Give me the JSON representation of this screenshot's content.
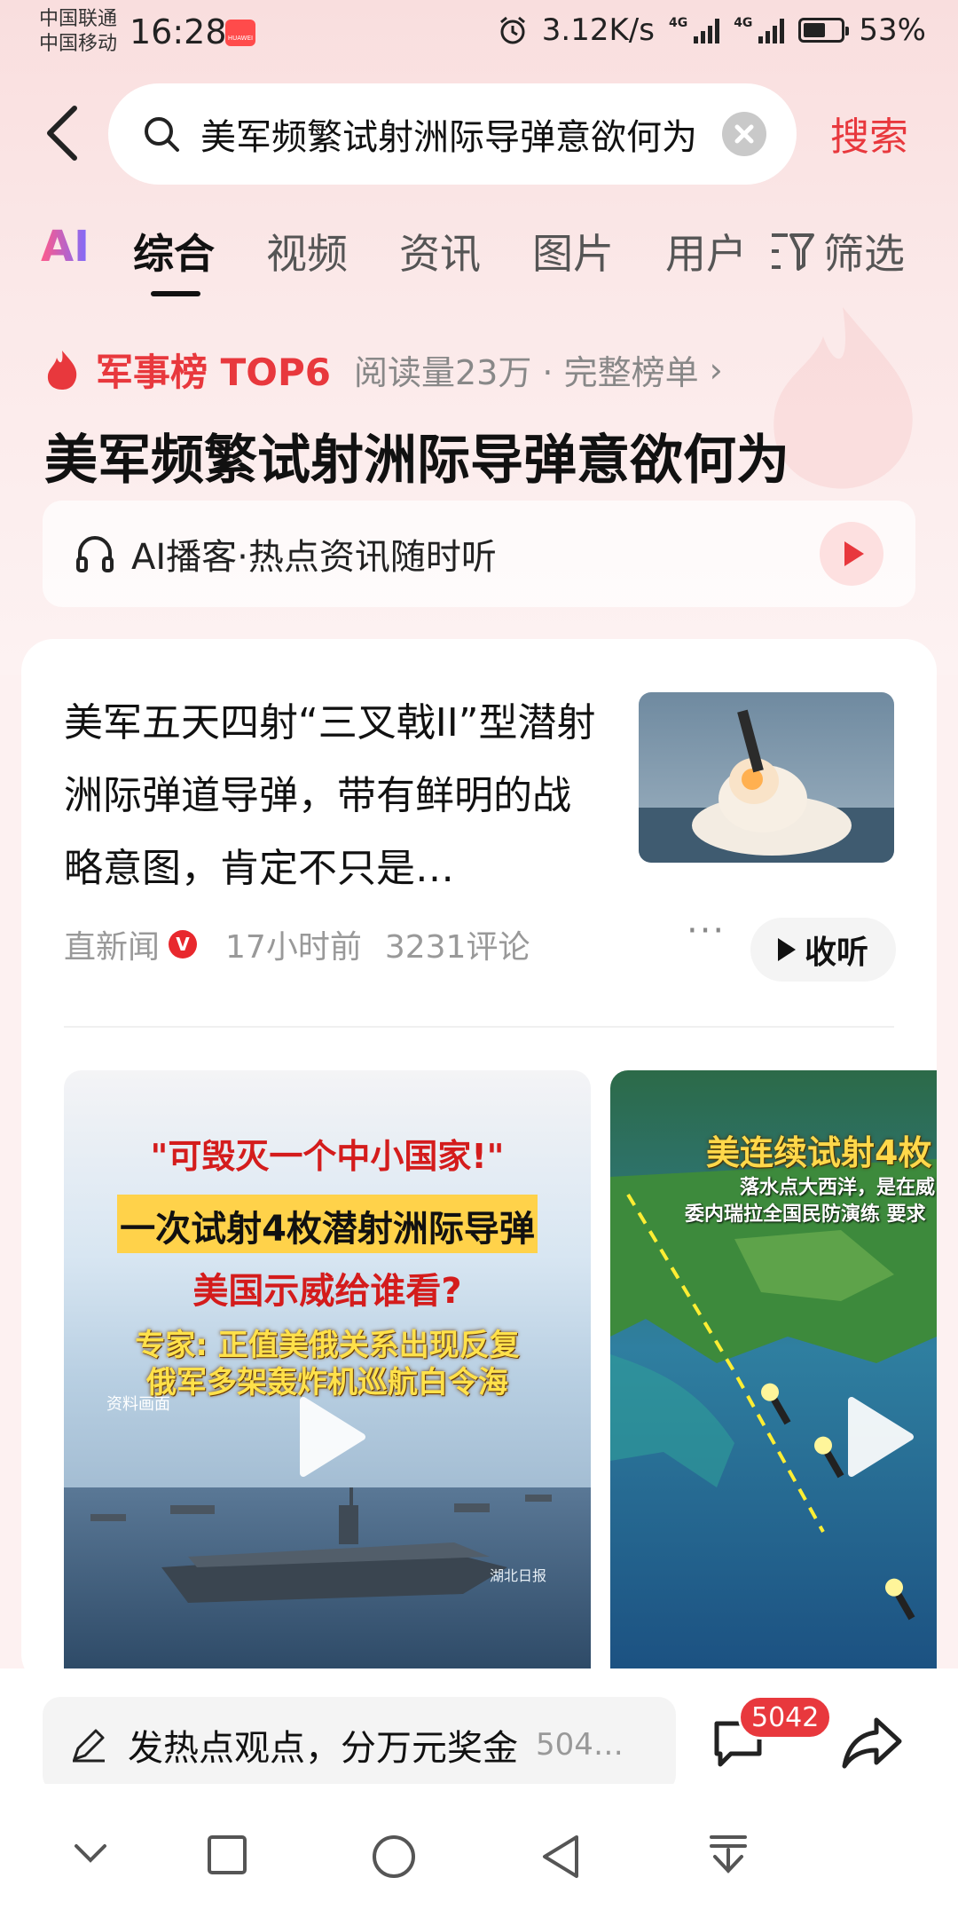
{
  "status_bar": {
    "carrier_1": "中国联通",
    "carrier_2": "中国移动",
    "time": "16:28",
    "network_speed": "3.12K/s",
    "signal_1": "4G",
    "signal_2": "4G",
    "battery": "53%"
  },
  "search": {
    "query": "美军频繁试射洲际导弹意欲何为",
    "submit_label": "搜索"
  },
  "tabs": {
    "ai": "AI",
    "items": [
      "综合",
      "视频",
      "资讯",
      "图片",
      "用户"
    ],
    "active": "综合",
    "filter_label": "筛选"
  },
  "hot_rank": {
    "rank_label": "军事榜 TOP6",
    "meta": "阅读量23万 · 完整榜单",
    "title": "美军频繁试射洲际导弹意欲何为"
  },
  "podcast": {
    "label": "AI播客·热点资讯随时听"
  },
  "article": {
    "title": "美军五天四射“三叉戟II”型潜射洲际弹道导弹，带有鲜明的战略意图，肯定不只是…",
    "source": "直新闻",
    "time": "17小时前",
    "comments": "3231评论",
    "more": "···",
    "listen_label": "收听"
  },
  "videos": [
    {
      "line1": "\"可毁灭一个中小国家!\"",
      "line2": "一次试射4枚潜射洲际导弹",
      "line3": "美国示威给谁看?",
      "line4": "专家: 正值美俄关系出现反复",
      "line5": "俄军多架轰炸机巡航白令海",
      "caption": "资料画面",
      "watermark": "湖北日报"
    },
    {
      "line1": "美连续试射4枚",
      "line2": "落水点大西洋，是在威",
      "line3": "委内瑞拉全国民防演练 要求"
    }
  ],
  "bottom_bar": {
    "comment_placeholder": "发热点观点，分万元奖金",
    "comment_extra": "504…",
    "comment_badge": "5042"
  },
  "colors": {
    "accent": "#e8383d",
    "background": "#fdf1f1"
  }
}
